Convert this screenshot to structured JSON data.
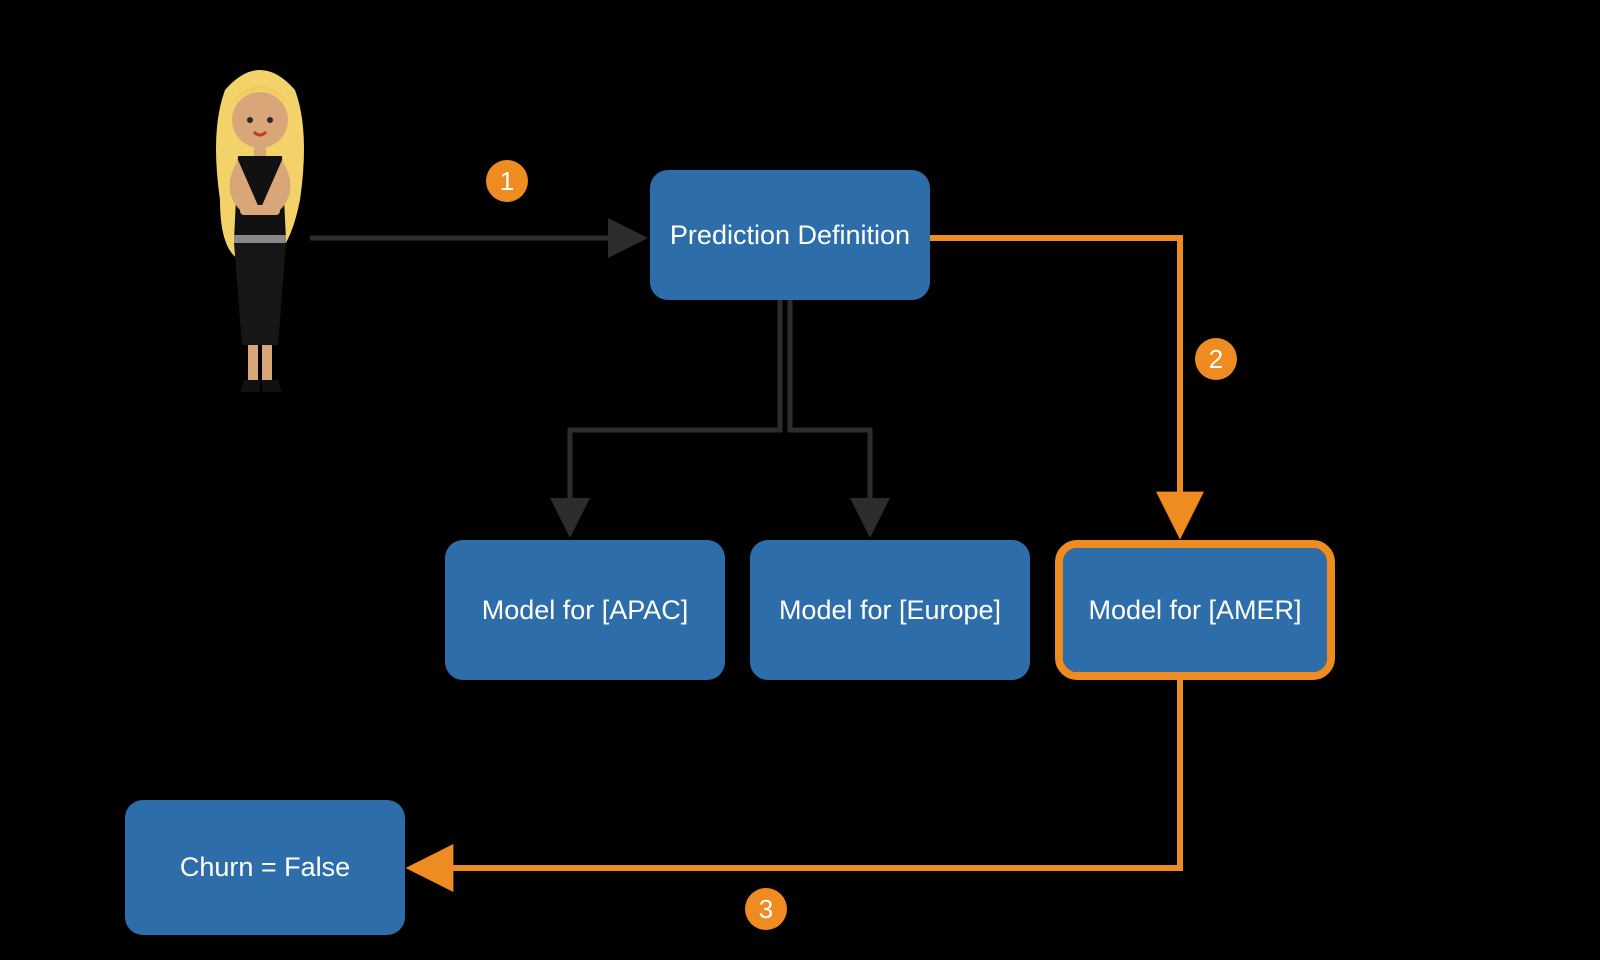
{
  "nodes": {
    "prediction": {
      "label": "Prediction Definition"
    },
    "model_apac": {
      "label": "Model for [APAC]"
    },
    "model_europe": {
      "label": "Model for [Europe]"
    },
    "model_amer": {
      "label": "Model for [AMER]",
      "highlighted": true
    },
    "result": {
      "label": "Churn = False"
    }
  },
  "badges": {
    "step1": "1",
    "step2": "2",
    "step3": "3"
  },
  "flow": {
    "steps": [
      {
        "from": "person",
        "to": "prediction",
        "badge": "1",
        "style": "dark"
      },
      {
        "from": "prediction",
        "to": "model_apac",
        "style": "dark"
      },
      {
        "from": "prediction",
        "to": "model_europe",
        "style": "dark"
      },
      {
        "from": "prediction",
        "to": "model_amer",
        "badge": "2",
        "style": "orange"
      },
      {
        "from": "model_amer",
        "to": "result",
        "badge": "3",
        "style": "orange"
      }
    ]
  },
  "colors": {
    "box_fill": "#2d6eaa",
    "highlight": "#ee8b21",
    "badge": "#ee8b21",
    "dark_line": "#2c2c2c",
    "orange_line": "#ee8b21"
  }
}
